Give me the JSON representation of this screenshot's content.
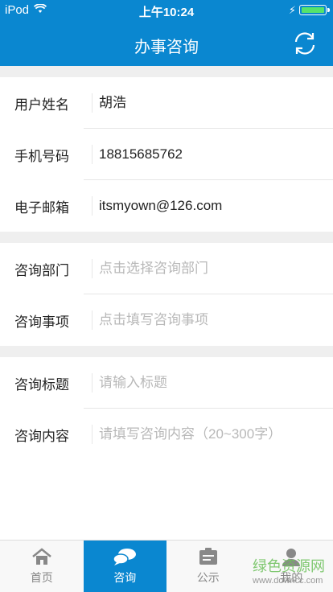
{
  "status": {
    "carrier": "iPod",
    "time": "上午10:24"
  },
  "header": {
    "title": "办事咨询"
  },
  "profile": [
    {
      "label": "用户姓名",
      "value": "胡浩"
    },
    {
      "label": "手机号码",
      "value": "18815685762"
    },
    {
      "label": "电子邮箱",
      "value": "itsmyown@126.com"
    }
  ],
  "department": {
    "label": "咨询部门",
    "placeholder": "点击选择咨询部门"
  },
  "matter": {
    "label": "咨询事项",
    "placeholder": "点击填写咨询事项"
  },
  "subject": {
    "label": "咨询标题",
    "placeholder": "请输入标题"
  },
  "content": {
    "label": "咨询内容",
    "placeholder": "请填写咨询内容（20~300字）"
  },
  "tabs": [
    {
      "label": "首页",
      "icon": "home-icon"
    },
    {
      "label": "咨询",
      "icon": "chat-icon"
    },
    {
      "label": "公示",
      "icon": "notice-icon"
    },
    {
      "label": "我的",
      "icon": "person-icon"
    }
  ],
  "watermark": {
    "text": "绿色资源网",
    "url": "www.downcc.com"
  },
  "colors": {
    "accent": "#0a87d0",
    "battery": "#55e36b"
  }
}
